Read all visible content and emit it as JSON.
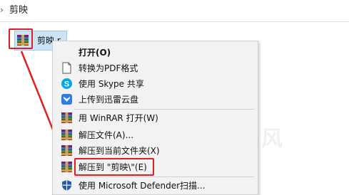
{
  "breadcrumb": {
    "chevron": "›",
    "folder": "剪映"
  },
  "file": {
    "name": "剪映.r",
    "icon": "winrar-archive-icon"
  },
  "watermark": "@源于风",
  "context_menu": {
    "items": [
      {
        "label": "打开(O)",
        "icon": "",
        "bold": true
      },
      {
        "label": "转换为PDF格式",
        "icon": "pdf-document-icon"
      },
      {
        "label": "使用 Skype 共享",
        "icon": "skype-icon"
      },
      {
        "label": "上传到迅雷云盘",
        "icon": "xunlei-cloud-icon"
      },
      {
        "label": "用 WinRAR 打开(W)",
        "icon": "winrar-icon"
      },
      {
        "label": "解压文件(A)...",
        "icon": "winrar-icon"
      },
      {
        "label": "解压到当前文件夹(X)",
        "icon": "winrar-icon"
      },
      {
        "label": "解压到 \"剪映\\\"(E)",
        "icon": "winrar-icon"
      },
      {
        "label": "使用 Microsoft Defender扫描...",
        "icon": "defender-shield-icon"
      }
    ]
  },
  "colors": {
    "highlight_red": "#e02020",
    "selection_blue": "#cce4f7",
    "menu_bg": "#f2f2f2"
  }
}
